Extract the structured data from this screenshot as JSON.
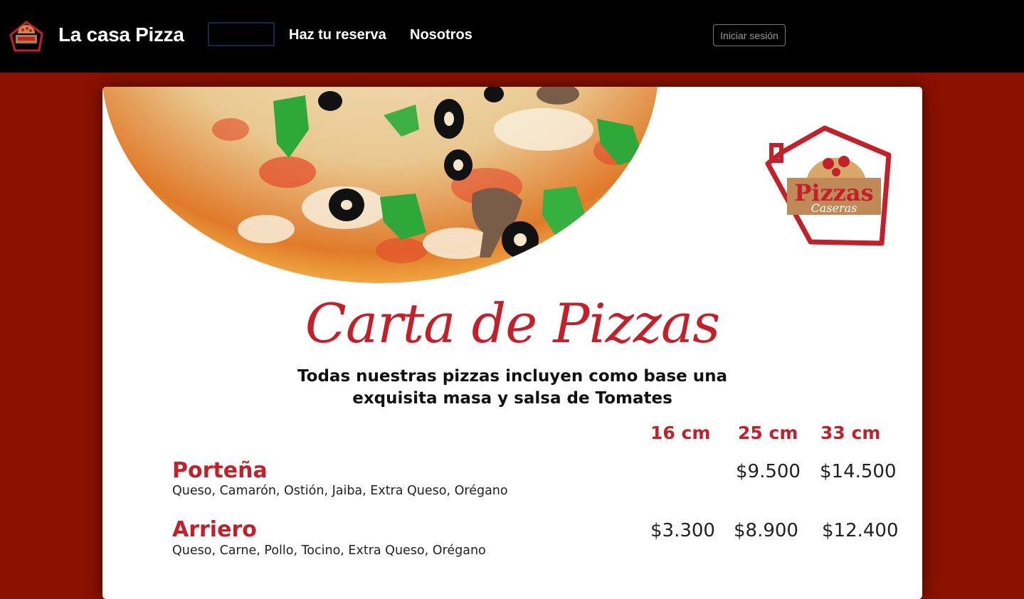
{
  "nav": {
    "brand": "La casa Pizza",
    "links": [
      "Haz tu reserva",
      "Nosotros"
    ],
    "login_label": "Iniciar sesión",
    "logo_text": "Pizzas Caseras"
  },
  "menu": {
    "logo_main": "Pizzas",
    "logo_sub": "Caseras",
    "title": "Carta de Pizzas",
    "subtitle_line1": "Todas nuestras pizzas incluyen como base una",
    "subtitle_line2": "exquisita masa y salsa de Tomates",
    "sizes": [
      "16 cm",
      "25 cm",
      "33 cm"
    ],
    "items": [
      {
        "name": "Porteña",
        "description": "Queso, Camarón, Ostión, Jaiba, Extra Queso, Orégano",
        "prices": [
          "",
          "$9.500",
          "$14.500"
        ]
      },
      {
        "name": "Arriero",
        "description": "Queso, Carne, Pollo, Tocino, Extra Queso, Orégano",
        "prices": [
          "$3.300",
          "$8.900",
          "$12.400"
        ]
      }
    ]
  },
  "colors": {
    "page_background": "#8b1100",
    "navbar": "#000000",
    "accent_red": "#c3202a"
  }
}
